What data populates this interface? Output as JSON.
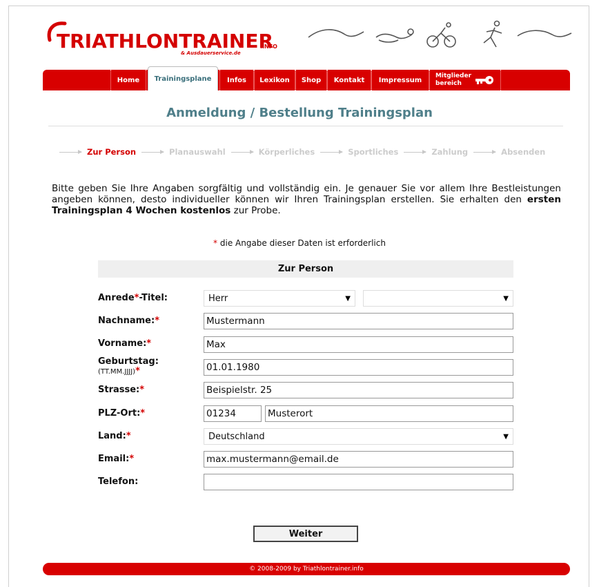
{
  "header": {
    "logo_text": "TRIATHLONTRAINER",
    "logo_suffix": ".INFO",
    "logo_sub": "& Ausdauerservice.de"
  },
  "nav": {
    "items": [
      "Home",
      "Trainingsplane",
      "Infos",
      "Lexikon",
      "Shop",
      "Kontakt",
      "Impressum"
    ],
    "member_line1": "Mitglieder",
    "member_line2": "bereich"
  },
  "page": {
    "title": "Anmeldung / Bestellung Trainingsplan"
  },
  "steps": [
    "Zur Person",
    "Planauswahl",
    "Körperliches",
    "Sportliches",
    "Zahlung",
    "Absenden"
  ],
  "intro": {
    "text_a": "Bitte geben Sie Ihre Angaben sorgfältig und vollständig ein. Je genauer Sie vor allem Ihre Bestleistungen angeben können, desto individueller können wir Ihren Trainingsplan erstellen. Sie erhalten den ",
    "text_bold": "ersten Trainingsplan 4 Wochen kostenlos",
    "text_b": " zur Probe."
  },
  "required_note": {
    "star": "*",
    "text": " die Angabe dieser Daten ist erforderlich"
  },
  "form": {
    "section_title": "Zur Person",
    "anrede_label": "Anrede",
    "titel_label": "-Titel:",
    "anrede_value": "Herr",
    "titel_value": "",
    "nachname_label": "Nachname:",
    "nachname_value": "Mustermann",
    "vorname_label": "Vorname:",
    "vorname_value": "Max",
    "geburtstag_label": "Geburtstag:",
    "geburtstag_hint": "(TT.MM.JJJJ)",
    "geburtstag_value": "01.01.1980",
    "strasse_label": "Strasse:",
    "strasse_value": "Beispielstr. 25",
    "plzort_label": "PLZ-Ort:",
    "plz_value": "01234",
    "ort_value": "Musterort",
    "land_label": "Land:",
    "land_value": "Deutschland",
    "email_label": "Email:",
    "email_value": "max.mustermann@email.de",
    "telefon_label": "Telefon:",
    "telefon_value": "",
    "star": "*",
    "submit_label": "Weiter"
  },
  "footer": {
    "text": "© 2008-2009 by Triathlontrainer.info"
  },
  "colors": {
    "brand_red": "#d80000",
    "title_teal": "#4f7f8a"
  }
}
